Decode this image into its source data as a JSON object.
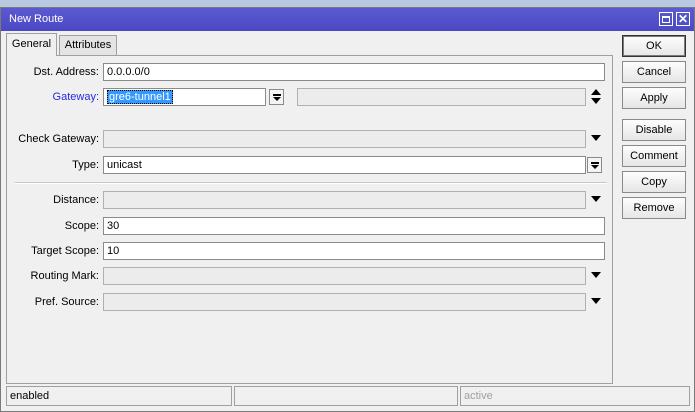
{
  "window": {
    "title": "New Route"
  },
  "tabs": [
    {
      "label": "General"
    },
    {
      "label": "Attributes"
    }
  ],
  "fields": {
    "dst_address": {
      "label": "Dst. Address:",
      "value": "0.0.0.0/0"
    },
    "gateway": {
      "label": "Gateway:",
      "value": "gre6-tunnel1"
    },
    "check_gateway": {
      "label": "Check Gateway:",
      "value": ""
    },
    "type": {
      "label": "Type:",
      "value": "unicast"
    },
    "distance": {
      "label": "Distance:",
      "value": ""
    },
    "scope": {
      "label": "Scope:",
      "value": "30"
    },
    "target_scope": {
      "label": "Target Scope:",
      "value": "10"
    },
    "routing_mark": {
      "label": "Routing Mark:",
      "value": ""
    },
    "pref_source": {
      "label": "Pref. Source:",
      "value": ""
    }
  },
  "buttons": {
    "ok": "OK",
    "cancel": "Cancel",
    "apply": "Apply",
    "disable": "Disable",
    "comment": "Comment",
    "copy": "Copy",
    "remove": "Remove"
  },
  "status": {
    "state": "enabled",
    "middle": "",
    "right": "active"
  },
  "colors": {
    "titlebar": "#4a48c4",
    "link": "#2a2ae0",
    "selection": "#3399ff"
  }
}
